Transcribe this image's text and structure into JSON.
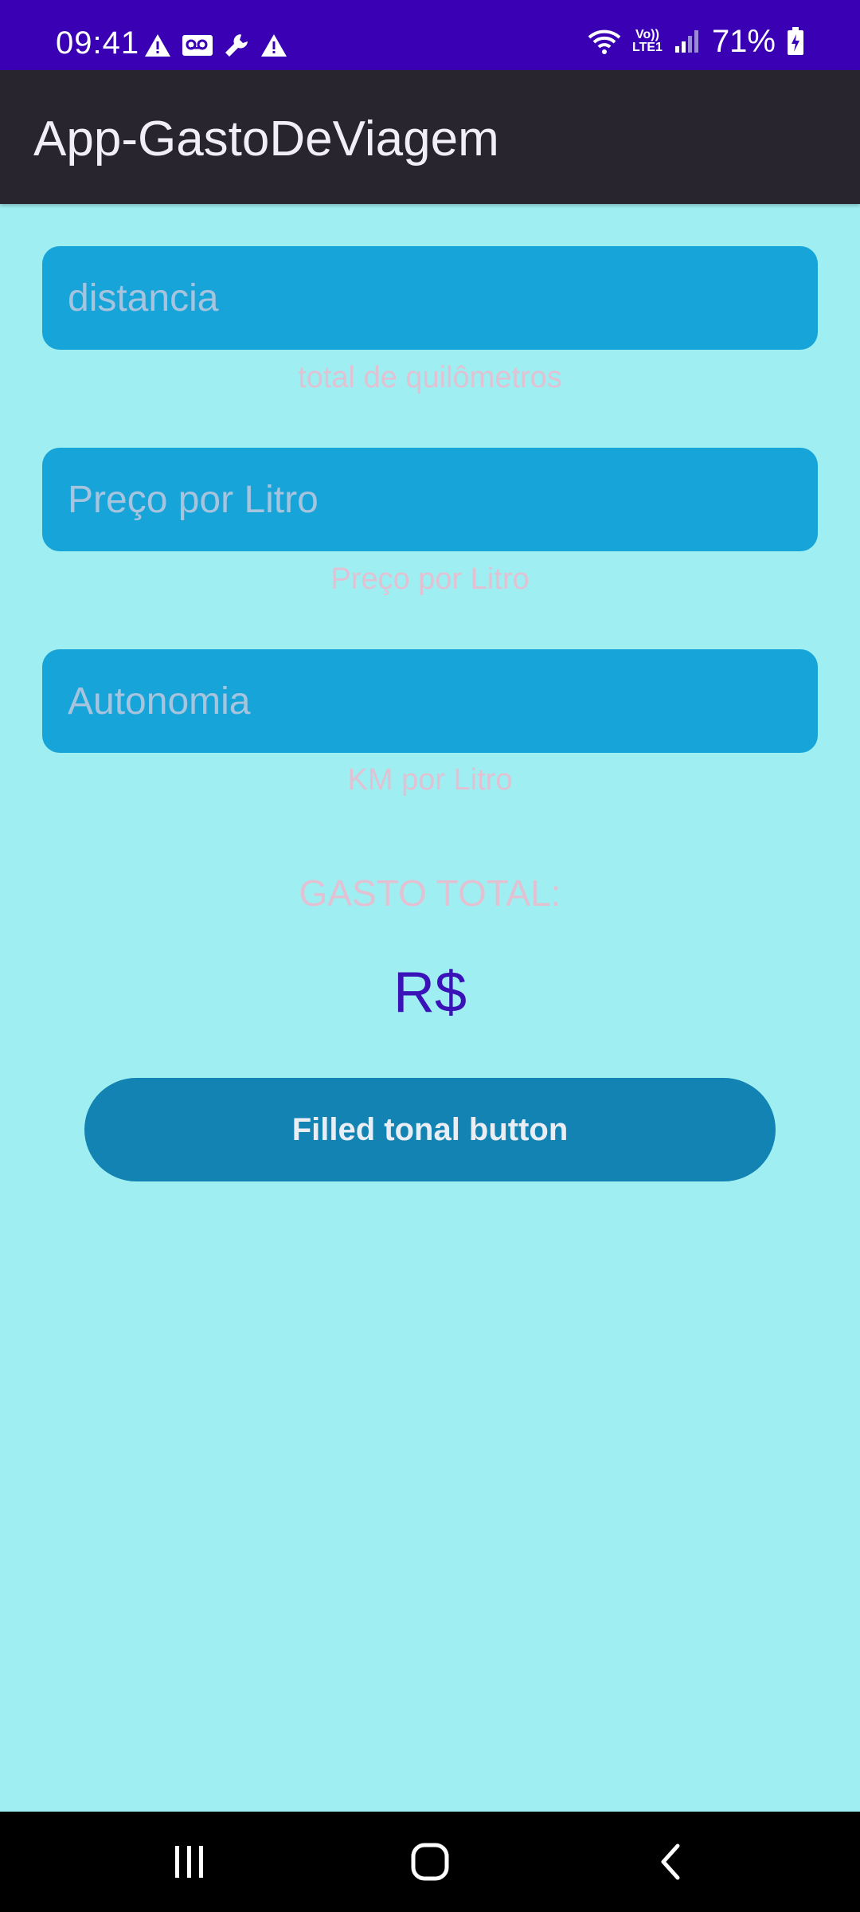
{
  "status_bar": {
    "time": "09:41",
    "battery_percent": "71%",
    "icons_left": [
      "warning-icon",
      "voicemail-icon",
      "wrench-icon",
      "warning-icon"
    ],
    "icons_right": [
      "wifi-icon",
      "volte-icon",
      "signal-icon",
      "battery-charging-icon"
    ],
    "network_label_top": "Vo))",
    "network_label_bottom": "LTE1",
    "color": "#3a00b4"
  },
  "app_bar": {
    "title": "App-GastoDeViagem",
    "color": "#29252f"
  },
  "form": {
    "distance": {
      "placeholder": "distancia",
      "value": "",
      "helper": "total de quilômetros"
    },
    "price": {
      "placeholder": "Preço por Litro",
      "value": "",
      "helper": "Preço por Litro"
    },
    "autonomy": {
      "placeholder": "Autonomia",
      "value": "",
      "helper": "KM por Litro"
    }
  },
  "result": {
    "label": "GASTO TOTAL:",
    "value": "R$"
  },
  "button": {
    "label": "Filled tonal button"
  },
  "colors": {
    "background": "#9feef2",
    "field": "#17a4d8",
    "button": "#1383b3",
    "accent_text": "#3a12b8",
    "helper_text": "#e2c2d2"
  },
  "nav_bar": {
    "items": [
      "recents-icon",
      "home-icon",
      "back-icon"
    ]
  }
}
